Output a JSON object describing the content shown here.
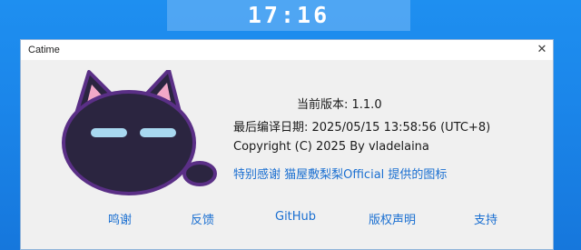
{
  "clock": {
    "time": "17:16"
  },
  "window": {
    "title": "Catime",
    "close_glyph": "✕"
  },
  "about": {
    "version": "当前版本: 1.1.0",
    "build_date": "最后编译日期:  2025/05/15 13:58:56 (UTC+8)",
    "copyright": "Copyright (C) 2025 By vladelaina",
    "credit": "特别感谢 猫屋敷梨梨Official 提供的图标"
  },
  "links": [
    {
      "label": "鸣谢"
    },
    {
      "label": "反馈"
    },
    {
      "label": "GitHub"
    },
    {
      "label": "版权声明"
    },
    {
      "label": "支持"
    }
  ],
  "colors": {
    "desktop": "#1b86ea",
    "window_bg": "#f0f0f0",
    "link": "#1a6fd1",
    "cat_body": "#2b2540",
    "cat_outline": "#5a2f86",
    "cat_eye": "#a8d8f0",
    "cat_ear_inner": "#f2a8c8"
  },
  "icons": {
    "logo": "black-cat-icon",
    "close": "close-icon"
  }
}
